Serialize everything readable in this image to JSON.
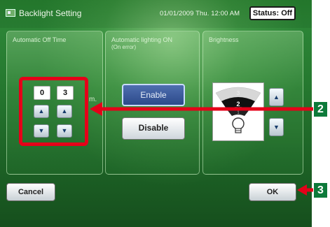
{
  "header": {
    "title": "Backlight Setting",
    "datetime": "01/01/2009 Thu. 12:00 AM",
    "status": "Status: Off"
  },
  "panels": {
    "auto_off": {
      "title": "Automatic Off Time",
      "digits": [
        "0",
        "3"
      ],
      "unit": "m."
    },
    "auto_light": {
      "title": "Automatic lighting ON",
      "subtitle": "(On error)",
      "enable_label": "Enable",
      "disable_label": "Disable"
    },
    "brightness": {
      "title": "Brightness",
      "levels": [
        "3",
        "2",
        "1"
      ],
      "current_level": "2"
    }
  },
  "footer": {
    "cancel_label": "Cancel",
    "ok_label": "OK"
  },
  "callouts": {
    "c2": "2",
    "c3": "3"
  },
  "icons": {
    "up": "▲",
    "down": "▼",
    "title_icon": "backlight-icon"
  },
  "colors": {
    "accent_red": "#e50019",
    "callout_green": "#0d7a3a",
    "screen_green": "#267a30"
  }
}
